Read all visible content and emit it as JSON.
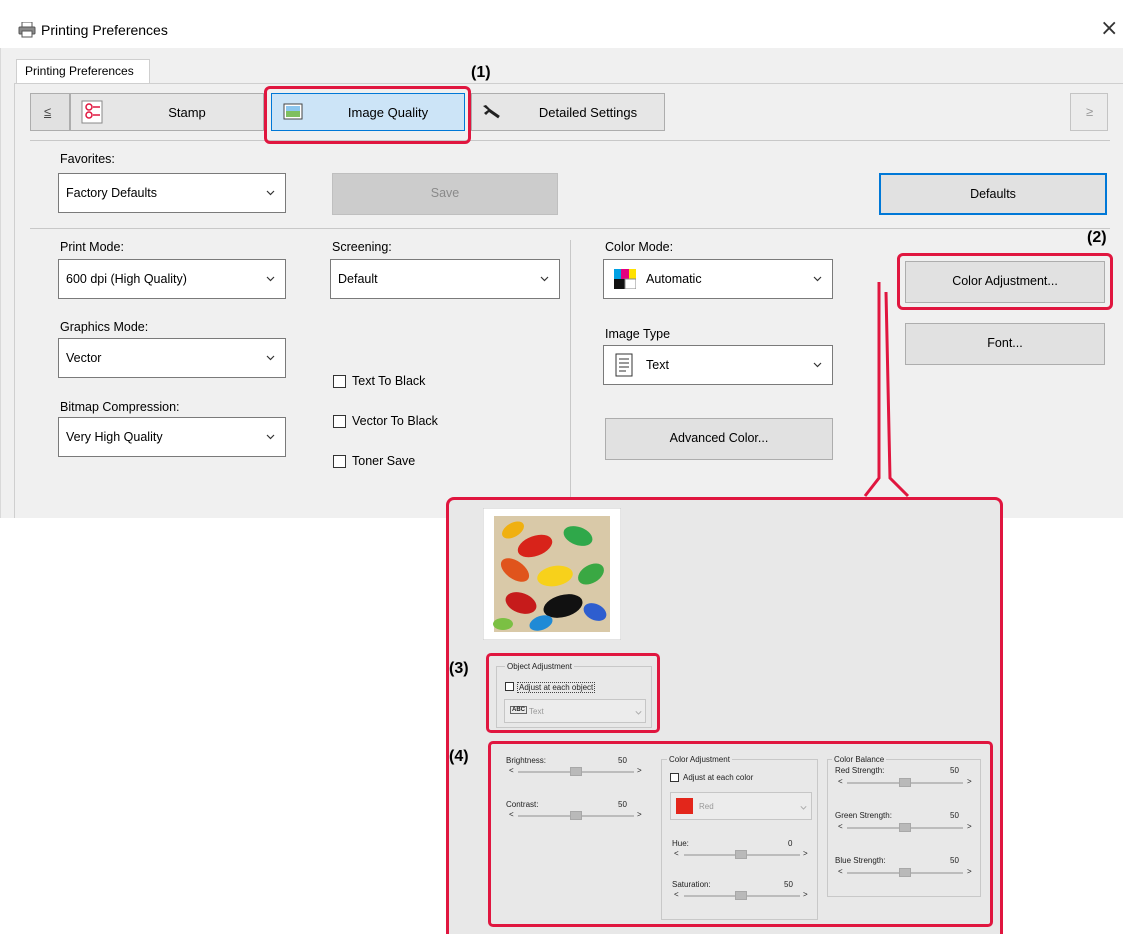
{
  "window": {
    "title": "Printing Preferences",
    "close_glyph": "×"
  },
  "outer_tab": "Printing Preferences",
  "nav": {
    "prev": "≤",
    "next": "≥",
    "tabs": [
      {
        "label": "Stamp",
        "icon": "stamp-icon"
      },
      {
        "label": "Image Quality",
        "icon": "image-quality-icon"
      },
      {
        "label": "Detailed Settings",
        "icon": "wrench-icon"
      }
    ]
  },
  "favorites": {
    "label": "Favorites:",
    "value": "Factory Defaults",
    "save": "Save",
    "defaults": "Defaults"
  },
  "print_mode": {
    "label": "Print Mode:",
    "value": "600 dpi (High Quality)"
  },
  "graphics_mode": {
    "label": "Graphics Mode:",
    "value": "Vector"
  },
  "bitmap_compression": {
    "label": "Bitmap Compression:",
    "value": "Very High Quality"
  },
  "screening": {
    "label": "Screening:",
    "value": "Default"
  },
  "checkboxes": {
    "text_to_black": "Text To Black",
    "vector_to_black": "Vector To Black",
    "toner_save": "Toner Save"
  },
  "color_mode": {
    "label": "Color Mode:",
    "value": "Automatic"
  },
  "image_type": {
    "label": "Image Type",
    "value": "Text"
  },
  "buttons": {
    "advanced_color": "Advanced Color...",
    "color_adjustment": "Color Adjustment...",
    "font": "Font..."
  },
  "callouts": {
    "c1": "(1)",
    "c2": "(2)",
    "c3": "(3)",
    "c4": "(4)"
  },
  "inset": {
    "object_adjustment": {
      "group": "Object Adjustment",
      "checkbox": "Adjust at each object",
      "dropdown": "Text",
      "dropdown_badge": "ABC"
    },
    "brightness": {
      "label": "Brightness:",
      "value": "50"
    },
    "contrast": {
      "label": "Contrast:",
      "value": "50"
    },
    "color_adjustment": {
      "group": "Color Adjustment",
      "checkbox": "Adjust at each color",
      "dropdown": "Red",
      "swatch_color": "#e3261b"
    },
    "hue": {
      "label": "Hue:",
      "value": "0"
    },
    "saturation": {
      "label": "Saturation:",
      "value": "50"
    },
    "color_balance": {
      "group": "Color Balance",
      "red": {
        "label": "Red Strength:",
        "value": "50"
      },
      "green": {
        "label": "Green Strength:",
        "value": "50"
      },
      "blue": {
        "label": "Blue Strength:",
        "value": "50"
      }
    },
    "arrow_left": "<",
    "arrow_right": ">"
  },
  "colors": {
    "highlight": "#e0163f",
    "selected_tab": "#cce4f7",
    "accent_blue": "#0078d7"
  }
}
